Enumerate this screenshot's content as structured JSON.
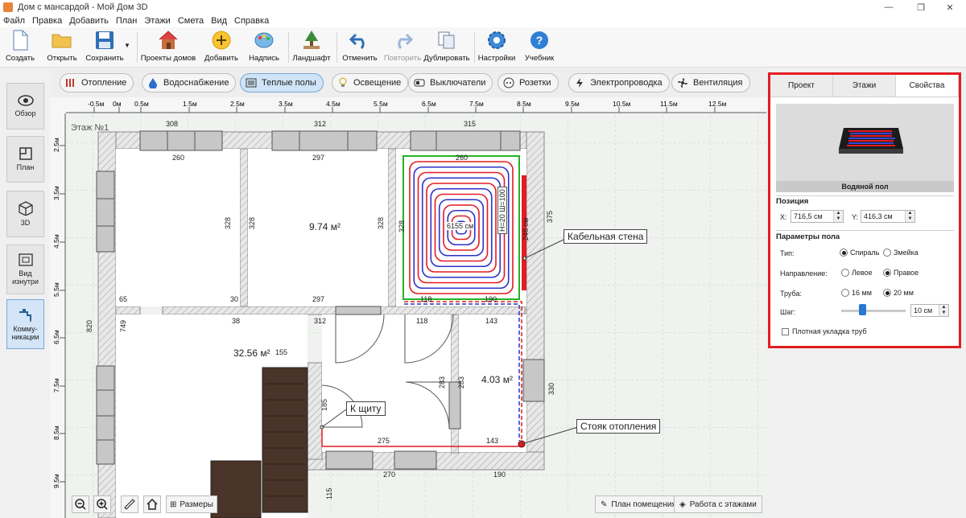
{
  "window": {
    "title": "Дом с мансардой - Мой Дом 3D",
    "minimize": "—",
    "maximize": "❐",
    "close": "✕"
  },
  "menu": [
    "Файл",
    "Правка",
    "Добавить",
    "План",
    "Этажи",
    "Смета",
    "Вид",
    "Справка"
  ],
  "toolbar": {
    "create": "Создать",
    "open": "Открыть",
    "save": "Сохранить",
    "projects": "Проекты домов",
    "add": "Добавить",
    "label": "Надпись",
    "landscape": "Ландшафт",
    "undo": "Отменить",
    "redo": "Повторить",
    "duplicate": "Дублировать",
    "settings": "Настройки",
    "tutorial": "Учебник"
  },
  "left_panel": {
    "overview": "Обзор",
    "plan": "План",
    "view3d": "3D",
    "inside": "Вид изнутри",
    "comms": "Комму-никации"
  },
  "categories": [
    "Отопление",
    "Водоснабжение",
    "Теплые полы",
    "Освещение",
    "Выключатели",
    "Розетки",
    "Электропроводка",
    "Вентиляция"
  ],
  "colors": {
    "accent": "#e31c23",
    "wall": "#d9d9d9",
    "floor_heating_red": "#e31c23",
    "floor_heating_blue": "#2b32c8",
    "selection": "#22b422"
  },
  "ruler_x": [
    "-0.5м",
    "0м",
    "0.5м",
    "1.5м",
    "2.5м",
    "3.5м",
    "4.5м",
    "5.5м",
    "6.5м",
    "7.5м",
    "8.5м",
    "9.5м",
    "10.5м",
    "11.5м",
    "12.5м"
  ],
  "ruler_y": [
    "2.5м",
    "3.5м",
    "4.5м",
    "5.5м",
    "6.5м",
    "7.5м",
    "8.5м",
    "9.5м"
  ],
  "plan": {
    "floor_label": "Этаж №1",
    "dims": {
      "top1": "308",
      "top2": "312",
      "top3": "315",
      "r1w": "260",
      "r2w": "297",
      "r3w": "260",
      "r1h": "328",
      "r2h": "328",
      "r2h2": "328",
      "r2b": "297",
      "r3h": "328",
      "r3r": "375",
      "r3h2": "248 см",
      "b118": "118",
      "b190": "190",
      "c65": "65",
      "c30": "30",
      "c38": "38",
      "c312": "312",
      "c118": "118",
      "c143": "143",
      "c820": "820",
      "c749": "749",
      "c155": "155",
      "c185": "185",
      "c275": "275",
      "c143b": "143",
      "c283a": "283",
      "c283b": "283",
      "c330": "330",
      "c270": "270",
      "c190b": "190",
      "c115": "115"
    },
    "room_area1": "9.74 м²",
    "room_area2": "32.56 м²",
    "room_area3": "4.03 м²",
    "heating_text": "6155 см",
    "heating_step": "Н=20 Ш=100",
    "callout_cable": "Кабельная стена",
    "callout_panel": "К щиту",
    "callout_riser": "Стояк отопления"
  },
  "bottom": {
    "room_plan": "План помещения",
    "floors_work": "Работа с этажами",
    "sizes": "Размеры"
  },
  "properties": {
    "tabs": [
      "Проект",
      "Этажи",
      "Свойства"
    ],
    "active_tab": "Свойства",
    "object_name": "Водяной пол",
    "position_title": "Позиция",
    "x_label": "X:",
    "x_value": "716,5 см",
    "y_label": "Y:",
    "y_value": "416,3 см",
    "params_title": "Параметры пола",
    "type_label": "Тип:",
    "type_spiral": "Спираль",
    "type_snake": "Змейка",
    "type_selected": "Спираль",
    "direction_label": "Направление:",
    "dir_left": "Левое",
    "dir_right": "Правое",
    "dir_selected": "Правое",
    "pipe_label": "Труба:",
    "pipe16": "16 мм",
    "pipe20": "20 мм",
    "pipe_selected": "20 мм",
    "step_label": "Шаг:",
    "step_value": "10 см",
    "step_slider": 0.3,
    "dense_label": "Плотная укладка труб",
    "dense_checked": false
  }
}
